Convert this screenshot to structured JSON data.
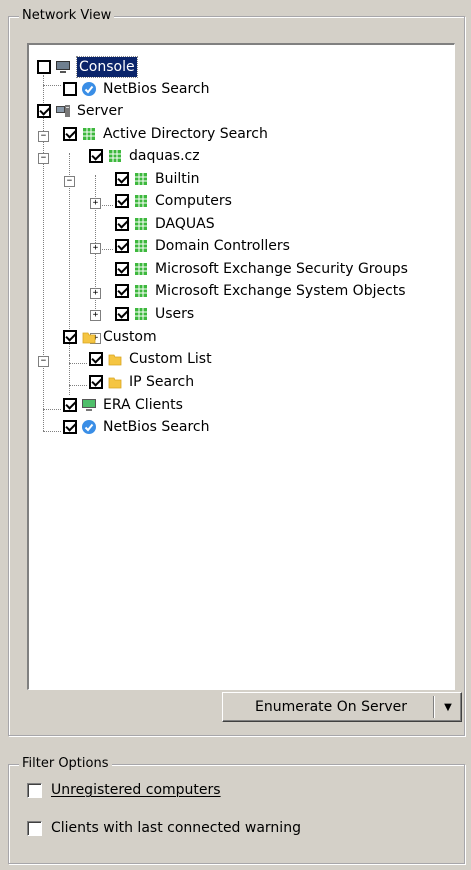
{
  "network_view": {
    "title": "Network View",
    "tree": [
      {
        "id": "console",
        "label": "Console",
        "checked": false,
        "icon": "monitor-icon",
        "selected": true
      },
      {
        "id": "console-netbios",
        "label": "NetBios Search",
        "checked": false,
        "icon": "netbios-icon"
      },
      {
        "id": "server",
        "label": "Server",
        "checked": true,
        "icon": "server-icon"
      },
      {
        "id": "ad-search",
        "label": "Active Directory Search",
        "checked": true,
        "icon": "ad-grid-icon",
        "expanded": true
      },
      {
        "id": "domain",
        "label": "daquas.cz",
        "checked": true,
        "icon": "ad-grid-icon",
        "expanded": true
      },
      {
        "id": "builtin",
        "label": "Builtin",
        "checked": true,
        "icon": "ad-grid-icon",
        "expander": "+"
      },
      {
        "id": "computers",
        "label": "Computers",
        "checked": true,
        "icon": "ad-grid-icon"
      },
      {
        "id": "daquas",
        "label": "DAQUAS",
        "checked": true,
        "icon": "ad-grid-icon",
        "expander": "+"
      },
      {
        "id": "domain-controllers",
        "label": "Domain Controllers",
        "checked": true,
        "icon": "ad-grid-icon"
      },
      {
        "id": "mesg",
        "label": "Microsoft Exchange Security Groups",
        "checked": true,
        "icon": "ad-grid-icon",
        "expander": "+"
      },
      {
        "id": "meso",
        "label": "Microsoft Exchange System Objects",
        "checked": true,
        "icon": "ad-grid-icon",
        "expander": "+"
      },
      {
        "id": "users",
        "label": "Users",
        "checked": true,
        "icon": "ad-grid-icon",
        "expander": "+"
      },
      {
        "id": "custom",
        "label": "Custom",
        "checked": true,
        "icon": "folder-icon",
        "expanded": true
      },
      {
        "id": "custom-list",
        "label": "Custom List",
        "checked": true,
        "icon": "folder-icon"
      },
      {
        "id": "ip-search",
        "label": "IP Search",
        "checked": true,
        "icon": "folder-icon"
      },
      {
        "id": "era-clients",
        "label": "ERA Clients",
        "checked": true,
        "icon": "era-monitor-icon"
      },
      {
        "id": "server-netbios",
        "label": "NetBios Search",
        "checked": true,
        "icon": "netbios-icon"
      }
    ]
  },
  "enumerate_button": {
    "label": "Enumerate On Server",
    "dropdown_icon": "dropdown-arrow-icon"
  },
  "filter_options": {
    "title": "Filter Options",
    "unregistered": {
      "label": "Unregistered computers",
      "checked": false
    },
    "last_connected": {
      "label": "Clients with last connected warning",
      "checked": false
    }
  },
  "colors": {
    "selection": "#0a246a",
    "netbios_blue": "#3a8ee6",
    "ad_green": "#3db83d",
    "folder_yellow": "#f5c542"
  }
}
